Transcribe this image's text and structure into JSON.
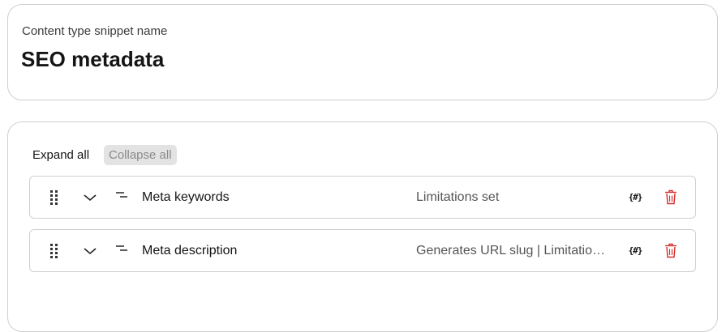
{
  "snippet": {
    "label": "Content type snippet name",
    "title": "SEO metadata"
  },
  "toolbar": {
    "expand_all": "Expand all",
    "collapse_all": "Collapse all"
  },
  "elements": [
    {
      "name": "Meta keywords",
      "limitations": "Limitations set",
      "continuous_generation": "{#}"
    },
    {
      "name": "Meta description",
      "limitations": "Generates URL slug | Limitations set",
      "continuous_generation": "{#}"
    }
  ],
  "colors": {
    "border": "#cfcfcf",
    "delete_icon": "#d32f2f",
    "collapse_bg": "#e3e3e3"
  },
  "icons": {
    "drag": "drag-handle-icon",
    "expand": "chevron-down-icon",
    "type": "text-type-icon",
    "generation": "curly-hash-icon",
    "delete": "trash-icon"
  }
}
